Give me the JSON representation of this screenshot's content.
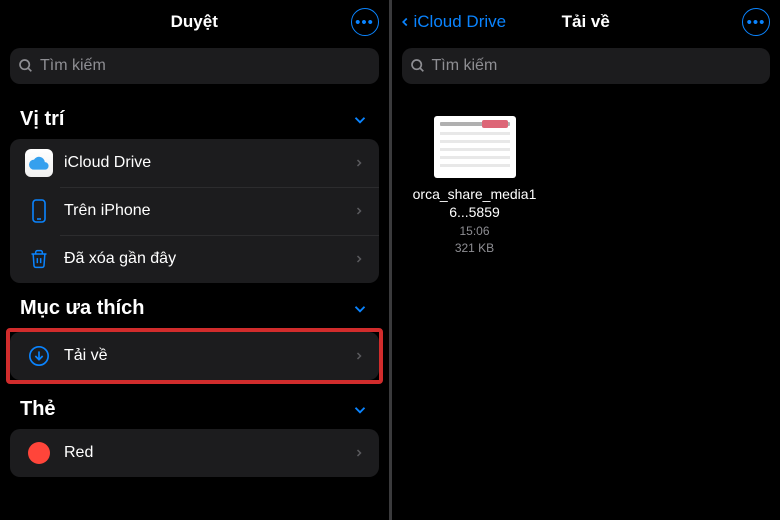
{
  "left": {
    "title": "Duyệt",
    "search_placeholder": "Tìm kiếm",
    "sections": {
      "locations": {
        "title": "Vị trí",
        "items": [
          {
            "label": "iCloud Drive"
          },
          {
            "label": "Trên iPhone"
          },
          {
            "label": "Đã xóa gần đây"
          }
        ]
      },
      "favorites": {
        "title": "Mục ưa thích",
        "items": [
          {
            "label": "Tải về"
          }
        ]
      },
      "tags": {
        "title": "Thẻ",
        "items": [
          {
            "label": "Red",
            "color": "#ff453a"
          }
        ]
      }
    }
  },
  "right": {
    "back_label": "iCloud Drive",
    "title": "Tải về",
    "search_placeholder": "Tìm kiếm",
    "files": [
      {
        "name": "orca_share_media16...5859",
        "time": "15:06",
        "size": "321 KB"
      }
    ]
  }
}
